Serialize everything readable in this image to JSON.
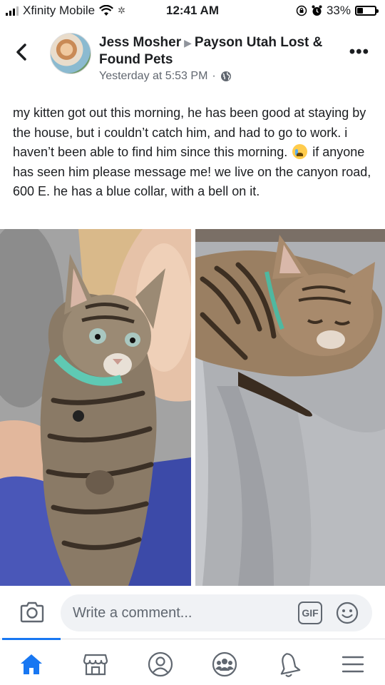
{
  "status_bar": {
    "carrier": "Xfinity Mobile",
    "time": "12:41 AM",
    "battery": "33%",
    "battery_level": 0.33
  },
  "post": {
    "author": "Jess Mosher",
    "group": "Payson Utah Lost & Found Pets",
    "timestamp": "Yesterday at 5:53 PM",
    "separator": "·",
    "privacy_icon": "globe-icon",
    "text_before_emoji": "my kitten got out this morning, he has been good at staying by the house, but i couldn’t catch him, and had to go to work. i haven’t been able to find him since this morning.",
    "emoji": "crying-face-emoji",
    "text_after_emoji": "if anyone has seen him please message me! we live on the canyon road, 600 E. he has a blue collar, with a bell on it."
  },
  "photos": [
    {
      "subject": "tabby kitten with teal collar held on shoulder"
    },
    {
      "subject": "tabby kitten sleeping on grey blanket"
    }
  ],
  "comment_bar": {
    "placeholder": "Write a comment...",
    "gif_label": "GIF",
    "camera_icon": "camera-icon",
    "emoji_icon": "smiley-icon"
  },
  "bottom_nav": {
    "active": "home",
    "items": [
      "home-icon",
      "marketplace-icon",
      "profile-icon",
      "groups-icon",
      "notifications-icon",
      "menu-icon"
    ]
  },
  "colors": {
    "accent": "#1877f2",
    "secondary_text": "#616770",
    "input_bg": "#f0f2f5"
  }
}
